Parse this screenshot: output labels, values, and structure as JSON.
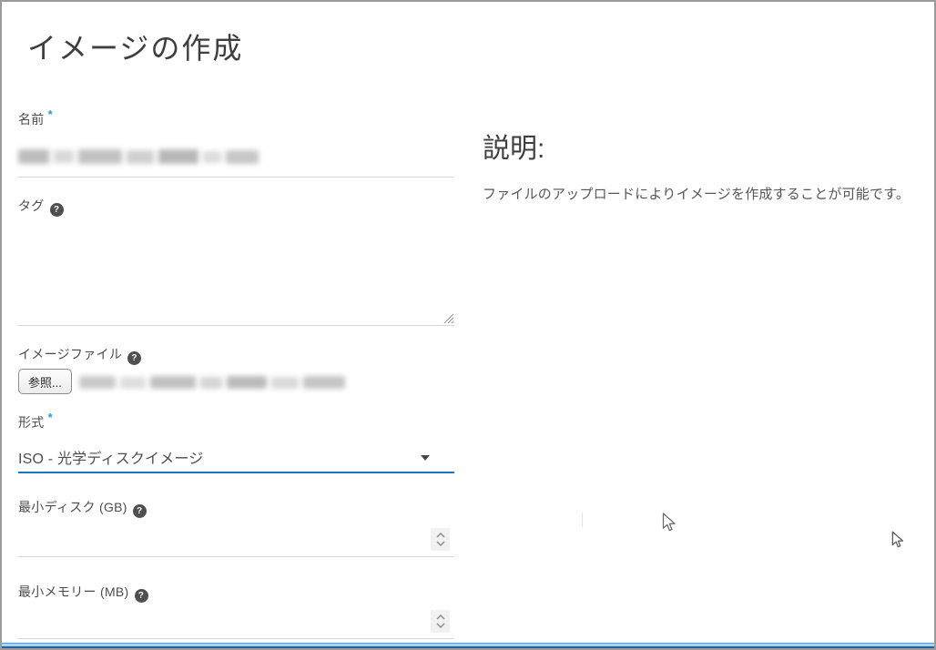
{
  "dialog": {
    "title": "イメージの作成"
  },
  "form": {
    "name": {
      "label": "名前",
      "required_marker": "*"
    },
    "tags": {
      "label": "タグ"
    },
    "image_file": {
      "label": "イメージファイル",
      "browse_label": "参照..."
    },
    "format": {
      "label": "形式",
      "required_marker": "*",
      "selected_option": "ISO - 光学ディスクイメージ"
    },
    "min_disk": {
      "label": "最小ディスク (GB)",
      "value": ""
    },
    "min_ram": {
      "label": "最小メモリー (MB)",
      "value": ""
    }
  },
  "help": {
    "heading": "説明:",
    "body": "ファイルのアップロードによりイメージを作成することが可能です。"
  },
  "icons": {
    "help": "?"
  },
  "colors": {
    "accent_blue_underline": "#1c79c0",
    "required_star_blue": "#2f96d8",
    "help_badge_gray": "#4f4f4f",
    "field_underline_gray": "#d8d8d8",
    "bottom_bar_blue": "#a9d3ef",
    "title_text": "#3e3e3e"
  }
}
